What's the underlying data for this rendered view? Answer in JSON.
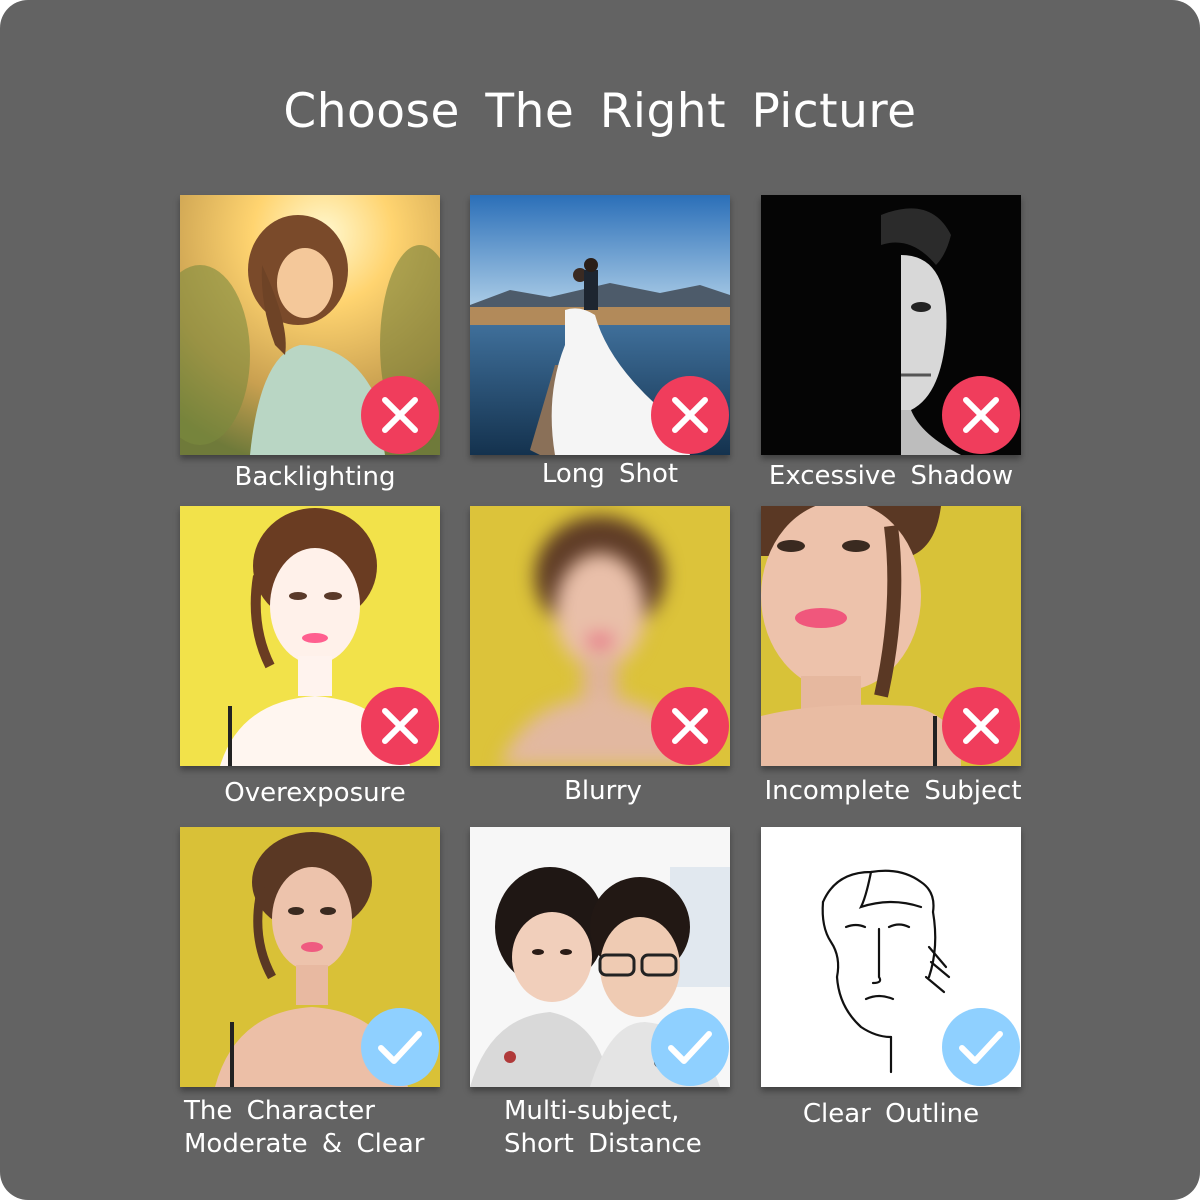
{
  "title": "Choose The Right Picture",
  "colors": {
    "background": "#636363",
    "title_text": "#ffffff",
    "bad_badge": "#f03d5c",
    "good_badge": "#8fd0ff"
  },
  "tiles": [
    {
      "label": "Backlighting",
      "verdict": "bad",
      "icon": "cross-icon"
    },
    {
      "label": "Long Shot",
      "verdict": "bad",
      "icon": "cross-icon"
    },
    {
      "label": "Excessive Shadow",
      "verdict": "bad",
      "icon": "cross-icon"
    },
    {
      "label": "Overexposure",
      "verdict": "bad",
      "icon": "cross-icon"
    },
    {
      "label": "Blurry",
      "verdict": "bad",
      "icon": "cross-icon"
    },
    {
      "label": "Incomplete Subject",
      "verdict": "bad",
      "icon": "cross-icon"
    },
    {
      "label_line1": "The Character",
      "label_line2": "Moderate & Clear",
      "verdict": "good",
      "icon": "check-icon"
    },
    {
      "label_line1": "Multi-subject,",
      "label_line2": "Short Distance",
      "verdict": "good",
      "icon": "check-icon"
    },
    {
      "label": "Clear Outline",
      "verdict": "good",
      "icon": "check-icon"
    }
  ]
}
